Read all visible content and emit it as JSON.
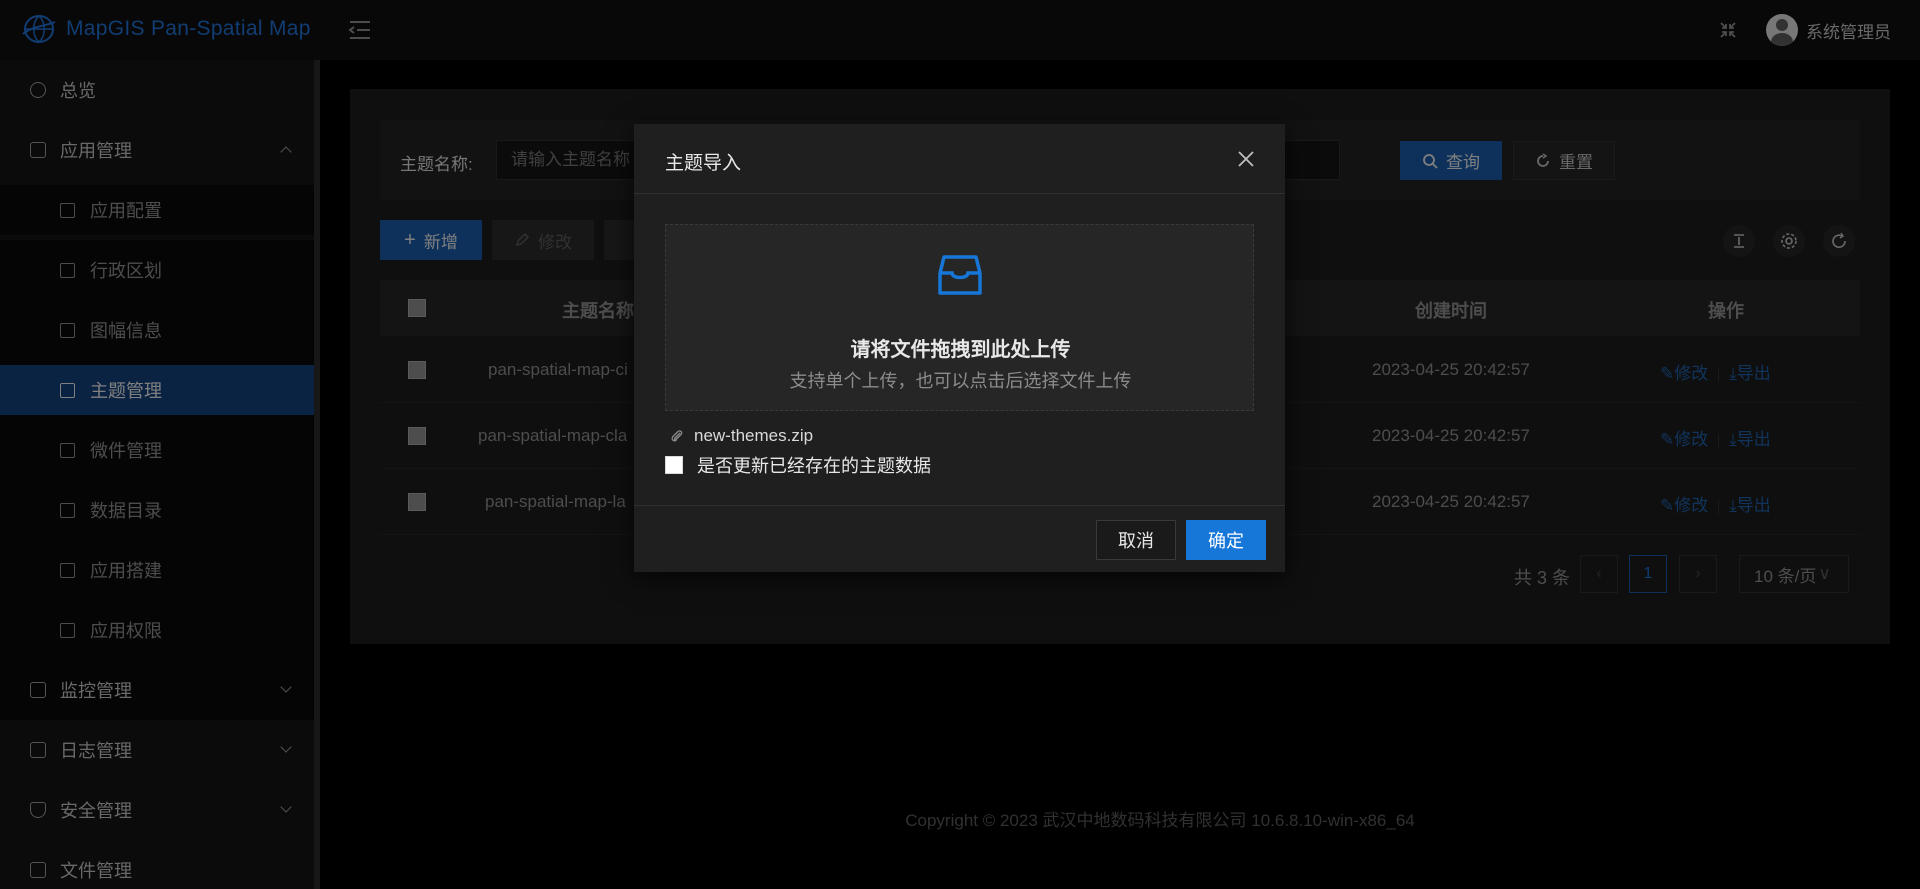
{
  "header": {
    "app_title": "MapGIS Pan-Spatial Map",
    "user_name": "系统管理员"
  },
  "sidebar": {
    "items": [
      {
        "label": "总览"
      },
      {
        "label": "应用管理"
      },
      {
        "label": "应用配置"
      },
      {
        "label": "行政区划"
      },
      {
        "label": "图幅信息"
      },
      {
        "label": "主题管理"
      },
      {
        "label": "微件管理"
      },
      {
        "label": "数据目录"
      },
      {
        "label": "应用搭建"
      },
      {
        "label": "应用权限"
      },
      {
        "label": "监控管理"
      },
      {
        "label": "日志管理"
      },
      {
        "label": "安全管理"
      },
      {
        "label": "文件管理"
      }
    ]
  },
  "search": {
    "label": "主题名称:",
    "placeholder": "请输入主题名称",
    "query_label": "查询",
    "reset_label": "重置"
  },
  "toolbar": {
    "add_label": "新增",
    "edit_label": "修改"
  },
  "table": {
    "headers": {
      "name": "主题名称",
      "created": "创建时间",
      "ops": "操作"
    },
    "rows": [
      {
        "name": "pan-spatial-map-ci",
        "created": "2023-04-25 20:42:57",
        "edit": "修改",
        "export": "导出"
      },
      {
        "name": "pan-spatial-map-cla",
        "created": "2023-04-25 20:42:57",
        "edit": "修改",
        "export": "导出"
      },
      {
        "name": "pan-spatial-map-la",
        "created": "2023-04-25 20:42:57",
        "edit": "修改",
        "export": "导出"
      }
    ]
  },
  "pagination": {
    "total": "共 3 条",
    "current_page": "1",
    "page_size": "10 条/页"
  },
  "footer": {
    "copyright": "Copyright © 2023 武汉中地数码科技有限公司 10.6.8.10-win-x86_64"
  },
  "modal": {
    "title": "主题导入",
    "drop_title": "请将文件拖拽到此处上传",
    "drop_hint": "支持单个上传，也可以点击后选择文件上传",
    "file_name": "new-themes.zip",
    "update_existing_label": "是否更新已经存在的主题数据",
    "cancel_label": "取消",
    "ok_label": "确定"
  },
  "colors": {
    "accent": "#1677d9",
    "active_menu": "#15417a",
    "link": "#1f5fa8"
  }
}
